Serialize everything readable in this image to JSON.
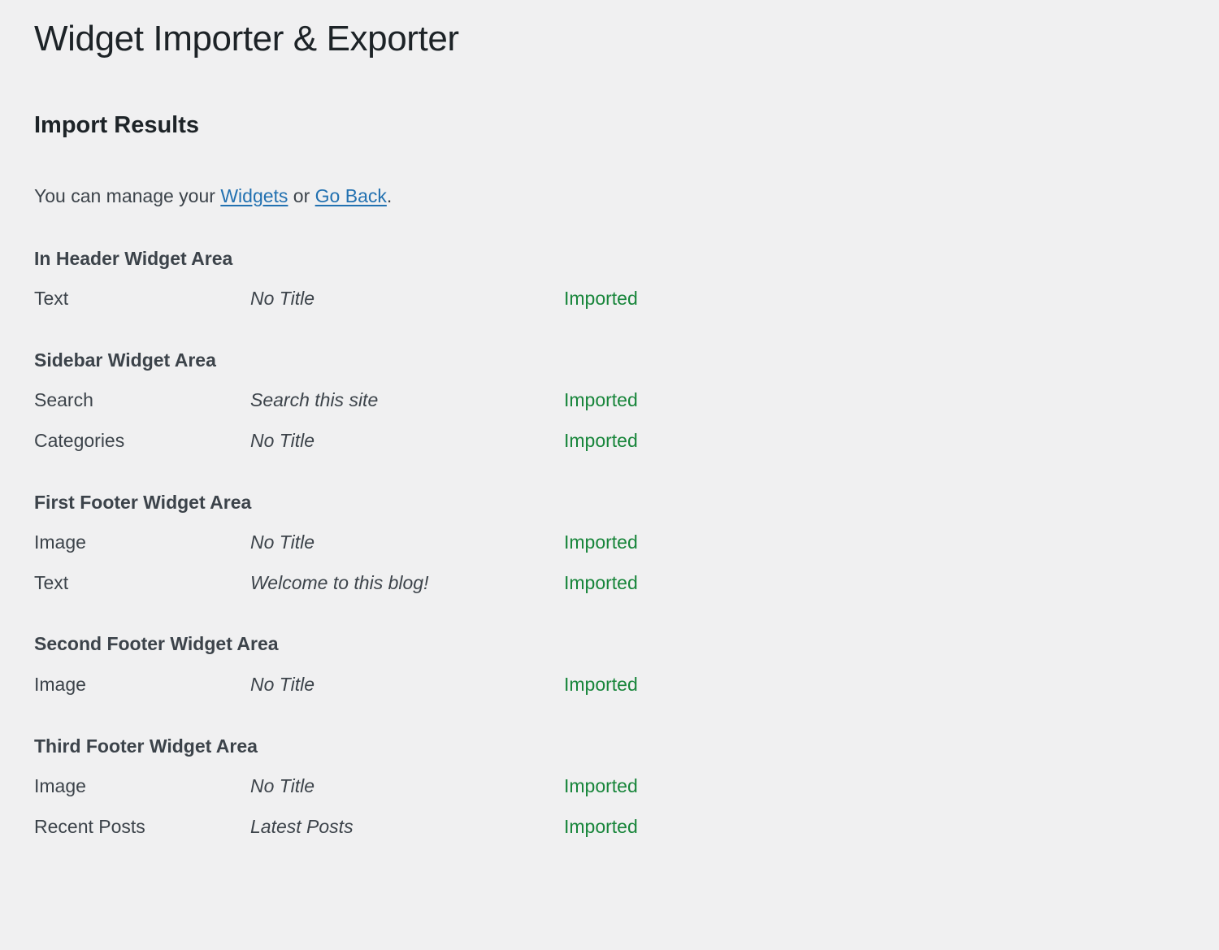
{
  "page": {
    "title": "Widget Importer & Exporter",
    "section_heading": "Import Results",
    "intro": {
      "before": "You can manage your ",
      "link_widgets": "Widgets",
      "between": " or ",
      "link_goback": "Go Back",
      "after": "."
    }
  },
  "colors": {
    "background": "#f0f0f1",
    "title_text": "#1d2327",
    "body_text": "#3c434a",
    "link": "#2271b1",
    "status_imported": "#17853a"
  },
  "results": {
    "areas": [
      {
        "heading": "In Header Widget Area",
        "rows": [
          {
            "name": "Text",
            "title": "No Title",
            "status": "Imported"
          }
        ]
      },
      {
        "heading": "Sidebar Widget Area",
        "rows": [
          {
            "name": "Search",
            "title": "Search this site",
            "status": "Imported"
          },
          {
            "name": "Categories",
            "title": "No Title",
            "status": "Imported"
          }
        ]
      },
      {
        "heading": "First Footer Widget Area",
        "rows": [
          {
            "name": "Image",
            "title": "No Title",
            "status": "Imported"
          },
          {
            "name": "Text",
            "title": "Welcome to this blog!",
            "status": "Imported"
          }
        ]
      },
      {
        "heading": "Second Footer Widget Area",
        "rows": [
          {
            "name": "Image",
            "title": "No Title",
            "status": "Imported"
          }
        ]
      },
      {
        "heading": "Third Footer Widget Area",
        "rows": [
          {
            "name": "Image",
            "title": "No Title",
            "status": "Imported"
          },
          {
            "name": "Recent Posts",
            "title": "Latest Posts",
            "status": "Imported"
          }
        ]
      }
    ]
  }
}
